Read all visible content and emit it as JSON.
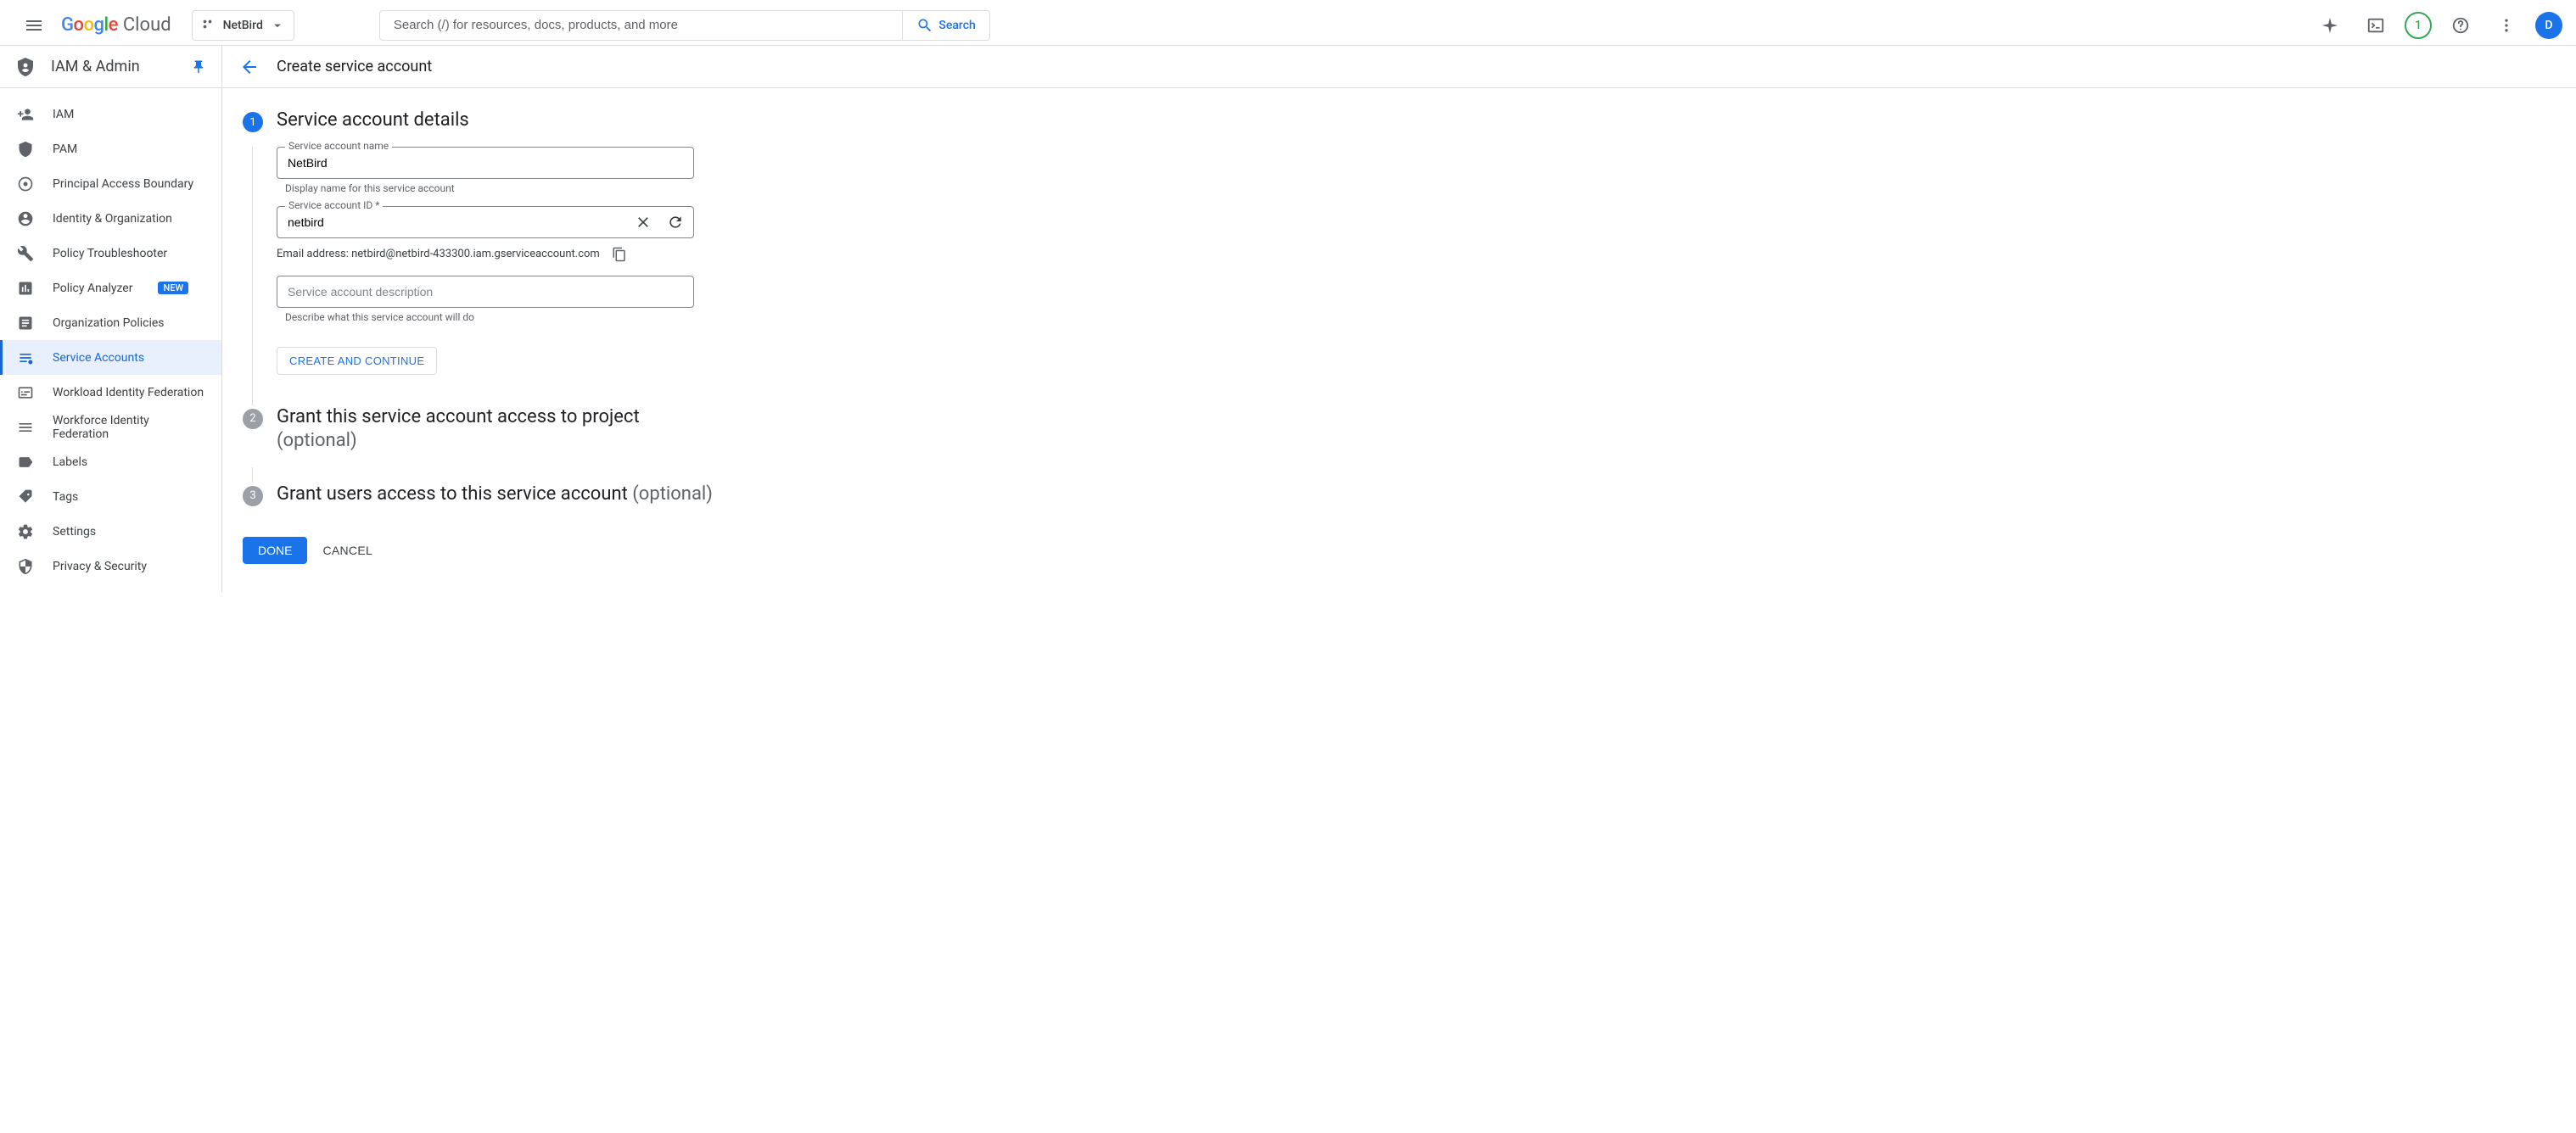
{
  "header": {
    "project_name": "NetBird",
    "search_placeholder": "Search (/) for resources, docs, products, and more",
    "search_button": "Search",
    "notification_count": "1",
    "avatar_letter": "D"
  },
  "sidebar": {
    "section_title": "IAM & Admin",
    "items": [
      {
        "label": "IAM",
        "icon": "person-add",
        "active": false
      },
      {
        "label": "PAM",
        "icon": "shield",
        "active": false
      },
      {
        "label": "Principal Access Boundary",
        "icon": "boundary",
        "active": false
      },
      {
        "label": "Identity & Organization",
        "icon": "account",
        "active": false
      },
      {
        "label": "Policy Troubleshooter",
        "icon": "wrench",
        "active": false
      },
      {
        "label": "Policy Analyzer",
        "icon": "analyzer",
        "active": false,
        "badge": "NEW"
      },
      {
        "label": "Organization Policies",
        "icon": "article",
        "active": false
      },
      {
        "label": "Service Accounts",
        "icon": "service-account",
        "active": true
      },
      {
        "label": "Workload Identity Federation",
        "icon": "workload",
        "active": false
      },
      {
        "label": "Workforce Identity Federation",
        "icon": "workforce",
        "active": false
      },
      {
        "label": "Labels",
        "icon": "label",
        "active": false
      },
      {
        "label": "Tags",
        "icon": "tag",
        "active": false
      },
      {
        "label": "Settings",
        "icon": "gear",
        "active": false
      },
      {
        "label": "Privacy & Security",
        "icon": "privacy",
        "active": false
      }
    ]
  },
  "main": {
    "title": "Create service account",
    "step1": {
      "num": "1",
      "title": "Service account details",
      "name_label": "Service account name",
      "name_value": "NetBird",
      "name_helper": "Display name for this service account",
      "id_label": "Service account ID *",
      "id_value": "netbird",
      "email_label": "Email address: netbird@netbird-433300.iam.gserviceaccount.com",
      "desc_placeholder": "Service account description",
      "desc_helper": "Describe what this service account will do",
      "create_continue": "CREATE AND CONTINUE"
    },
    "step2": {
      "num": "2",
      "title": "Grant this service account access to project",
      "optional": "(optional)"
    },
    "step3": {
      "num": "3",
      "title": "Grant users access to this service account ",
      "optional": "(optional)"
    },
    "actions": {
      "done": "DONE",
      "cancel": "CANCEL"
    }
  }
}
